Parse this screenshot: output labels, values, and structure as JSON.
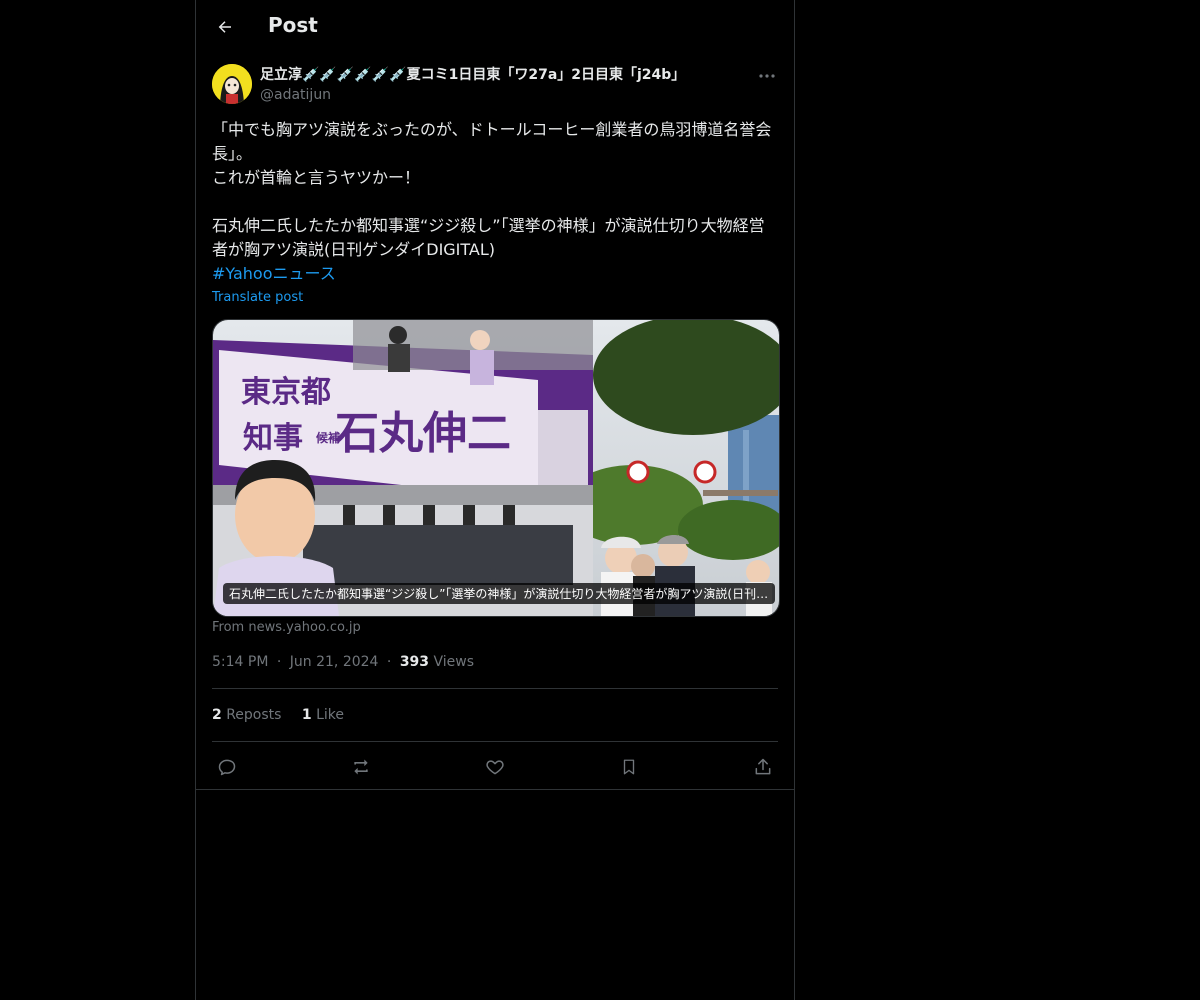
{
  "header": {
    "title": "Post",
    "back_icon": "arrow-left-icon"
  },
  "post": {
    "display_name": "足立淳💉💉💉💉💉💉夏コミ1日目東「ワ27a」2日目東「j24b」",
    "handle": "@adatijun",
    "more_icon": "more-horizontal-icon",
    "body": "「中でも胸アツ演説をぶったのが、ドトールコーヒー創業者の鳥羽博道名誉会長」。\nこれが首輪と言うヤツかー！\n\n石丸伸二氏したたか都知事選“ジジ殺し”「選挙の神様」が演説仕切り大物経営者が胸アツ演説(日刊ゲンダイDIGITAL)",
    "hashtag": "#Yahooニュース",
    "translate": "Translate post",
    "card": {
      "banner_line1": "東京都",
      "banner_line2": "知事",
      "banner_tag": "候補",
      "banner_name": "石丸伸二",
      "caption": "石丸伸二氏したたか都知事選“ジジ殺し”「選挙の神様」が演説仕切り大物経営者が胸アツ演説(日刊ゲンダイDIGITAL)",
      "source": "From news.yahoo.co.jp"
    },
    "time": "5:14 PM",
    "dot": "·",
    "date": "Jun 21, 2024",
    "views_count": "393",
    "views_label": "Views",
    "reposts_count": "2",
    "reposts_label": "Reposts",
    "likes_count": "1",
    "likes_label": "Like",
    "colors": {
      "accent": "#1d9bf0",
      "banner": "#5b2a86",
      "muted": "#71767b"
    }
  }
}
